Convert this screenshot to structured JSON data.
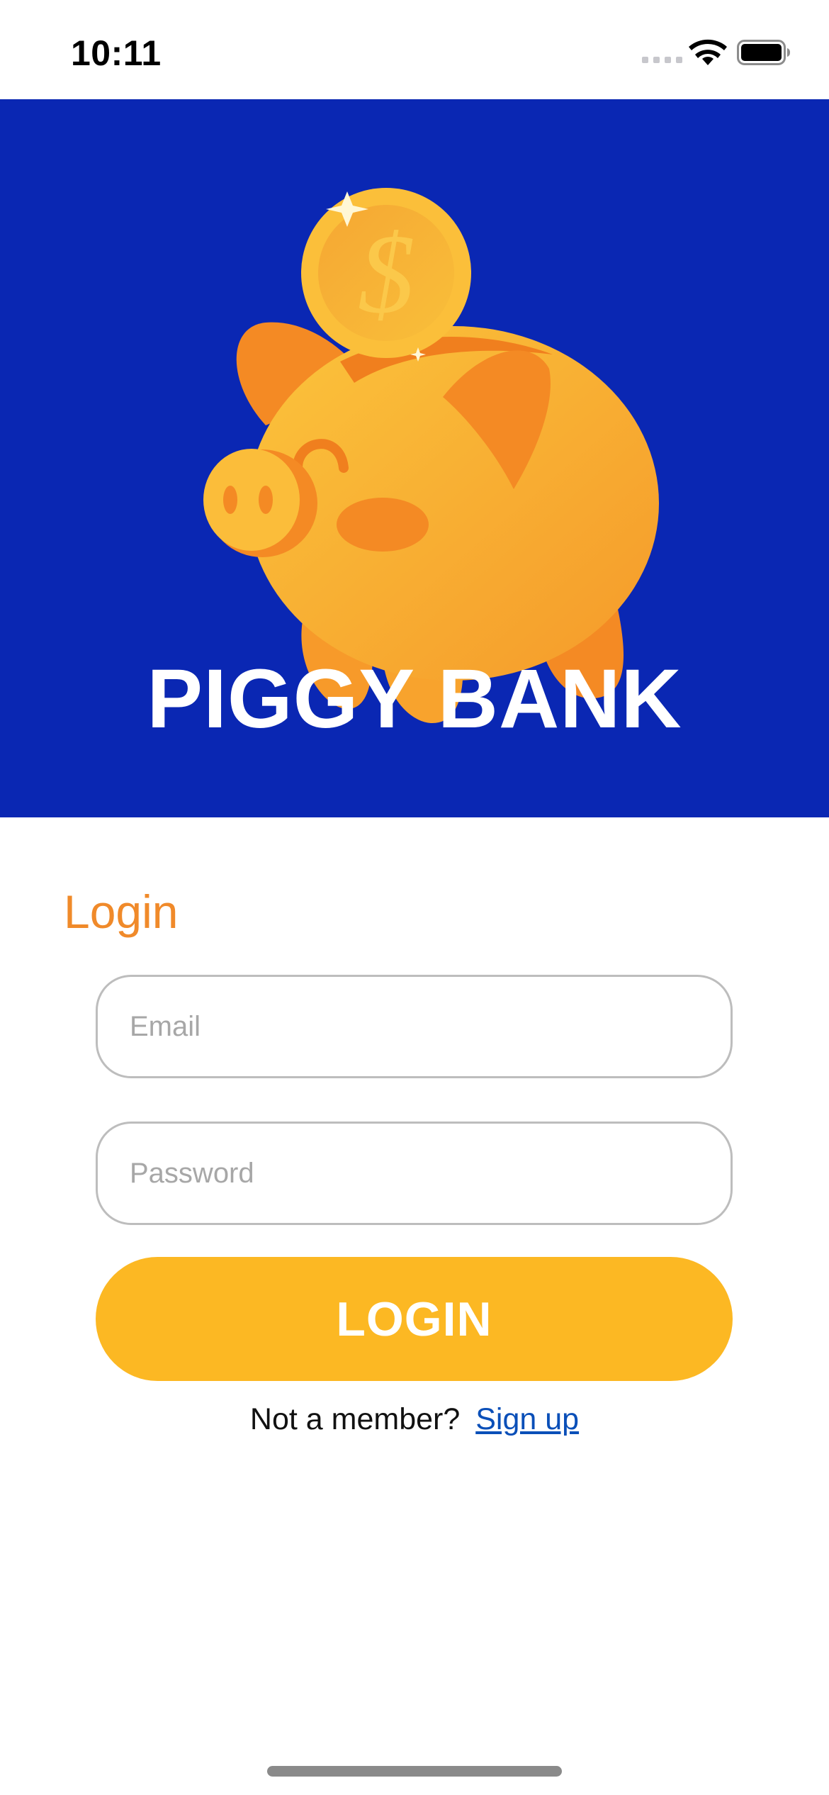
{
  "status_bar": {
    "time": "10:11"
  },
  "hero": {
    "title": "PIGGY BANK",
    "background_color": "#0a27b3",
    "illustration": "piggy-bank-with-coin"
  },
  "login_form": {
    "heading": "Login",
    "email": {
      "placeholder": "Email",
      "value": ""
    },
    "password": {
      "placeholder": "Password",
      "value": ""
    },
    "submit_label": "LOGIN",
    "signup_prompt": "Not a member?",
    "signup_link": "Sign up"
  },
  "colors": {
    "accent_orange": "#f08a2a",
    "button_yellow": "#fcb823",
    "link_blue": "#0a4fb8"
  }
}
